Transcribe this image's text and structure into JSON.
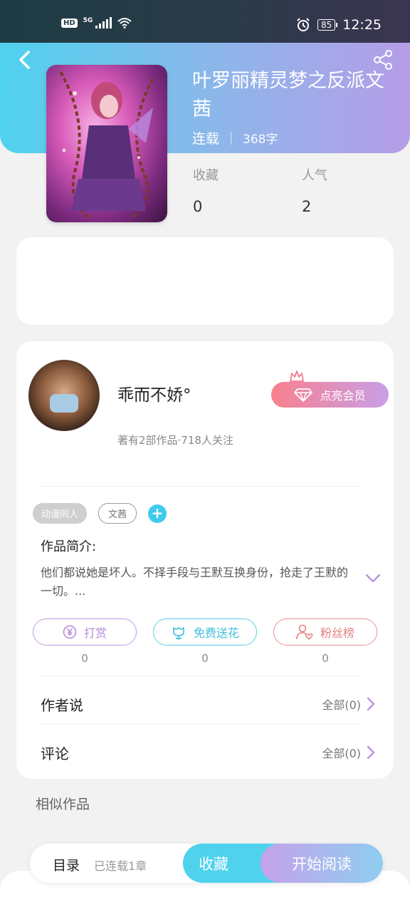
{
  "status_bar": {
    "hd": "HD",
    "network": "5G",
    "battery": "85",
    "time": "12:25"
  },
  "book": {
    "title": "叶罗丽精灵梦之反派文茜",
    "status": "连载",
    "words": "368字",
    "stats": [
      {
        "label": "收藏",
        "value": "0"
      },
      {
        "label": "人气",
        "value": "2"
      }
    ]
  },
  "author": {
    "name": "乖而不娇°",
    "vip_button": "点亮会员",
    "stats_text": "著有2部作品·718人关注"
  },
  "tags": [
    "动漫同人",
    "文茜"
  ],
  "add_tag": "+",
  "intro": {
    "title": "作品简介:",
    "text": "他们都说她是坏人。不择手段与王默互换身份，抢走了王默的一切。..."
  },
  "actions": [
    {
      "label": "打赏",
      "count": "0",
      "color": "#b78bd8"
    },
    {
      "label": "免费送花",
      "count": "0",
      "color": "#3fbfdb"
    },
    {
      "label": "粉丝榜",
      "count": "0",
      "color": "#e57f7f"
    }
  ],
  "rows": [
    {
      "title": "作者说",
      "right": "全部(0)"
    },
    {
      "title": "评论",
      "right": "全部(0)"
    }
  ],
  "similar_title": "相似作品",
  "bottom_bar": {
    "toc": "目录",
    "toc_status": "已连载1章",
    "favorite": "收藏",
    "start_reading": "开始阅读"
  },
  "colors": {
    "accent_cyan": "#4fd2ee",
    "accent_purple": "#b59de8",
    "vip_pink": "#f8808e"
  },
  "icons": [
    "back-arrow-icon",
    "share-icon",
    "crown-icon",
    "diamond-icon",
    "yen-icon",
    "flower-icon",
    "person-heart-icon",
    "chevron-down-icon",
    "chevron-right-icon"
  ]
}
